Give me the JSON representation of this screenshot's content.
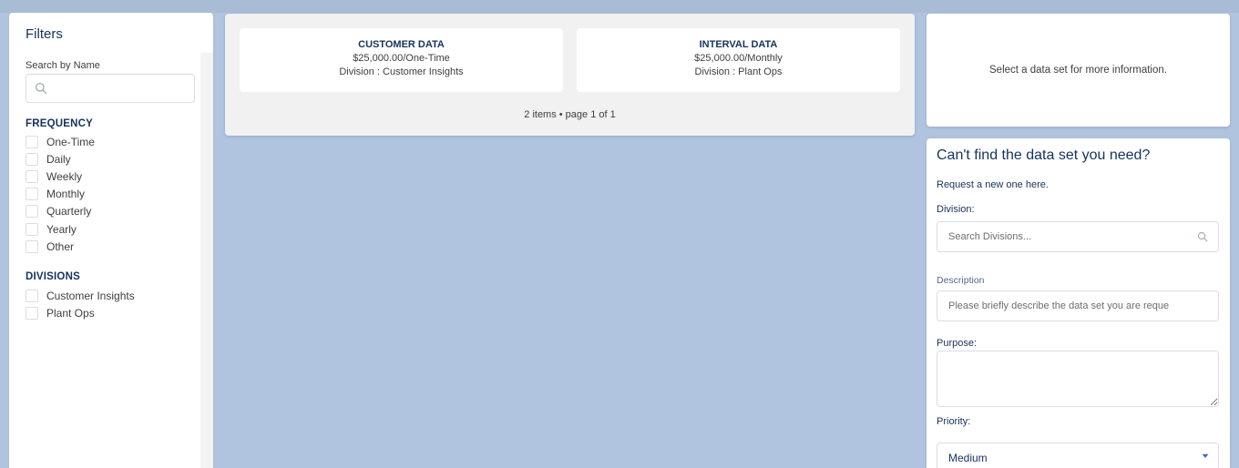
{
  "filters": {
    "title": "Filters",
    "search_label": "Search by Name",
    "search_placeholder": "",
    "frequency_title": "FREQUENCY",
    "frequency_options": [
      "One-Time",
      "Daily",
      "Weekly",
      "Monthly",
      "Quarterly",
      "Yearly",
      "Other"
    ],
    "divisions_title": "DIVISIONS",
    "division_options": [
      "Customer Insights",
      "Plant Ops"
    ]
  },
  "results": {
    "cards": [
      {
        "title": "CUSTOMER DATA",
        "price": "$25,000.00/One-Time",
        "division": "Division : Customer Insights"
      },
      {
        "title": "INTERVAL DATA",
        "price": "$25,000.00/Monthly",
        "division": "Division : Plant Ops"
      }
    ],
    "pager": "2 items • page 1 of 1"
  },
  "info": {
    "message": "Select a data set for more information."
  },
  "request_form": {
    "title": "Can't find the data set you need?",
    "subtitle": "Request a new one here.",
    "division_label": "Division:",
    "division_placeholder": "Search Divisions...",
    "description_label": "Description",
    "description_placeholder": "Please briefly describe the data set you are reque",
    "purpose_label": "Purpose:",
    "priority_label": "Priority:",
    "priority_value": "Medium"
  },
  "colors": {
    "background": "#b0c4df",
    "text_primary": "#16325c",
    "border": "#d8dde6"
  }
}
